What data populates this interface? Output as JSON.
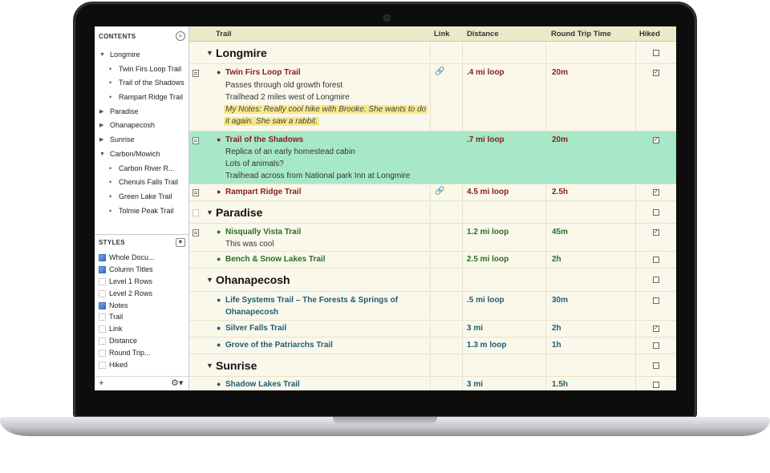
{
  "sidebar": {
    "contents_heading": "CONTENTS",
    "contents": [
      {
        "label": "Longmire",
        "level": 1,
        "expanded": true
      },
      {
        "label": "Twin Firs Loop Trail",
        "level": 2
      },
      {
        "label": "Trail of the Shadows",
        "level": 2
      },
      {
        "label": "Rampart Ridge Trail",
        "level": 2
      },
      {
        "label": "Paradise",
        "level": 1,
        "expanded": false
      },
      {
        "label": "Ohanapecosh",
        "level": 1,
        "expanded": false
      },
      {
        "label": "Sunrise",
        "level": 1,
        "expanded": false
      },
      {
        "label": "Carbon/Mowich",
        "level": 1,
        "expanded": true
      },
      {
        "label": "Carbon River R...",
        "level": 2
      },
      {
        "label": "Chenuis Falls Trail",
        "level": 2
      },
      {
        "label": "Green Lake Trail",
        "level": 2
      },
      {
        "label": "Tolmie Peak Trail",
        "level": 2
      }
    ],
    "styles_heading": "STYLES",
    "styles": [
      {
        "label": "Whole Docu...",
        "filled": true
      },
      {
        "label": "Column Titles",
        "filled": true
      },
      {
        "label": "Level 1 Rows",
        "filled": false
      },
      {
        "label": "Level 2 Rows",
        "filled": false
      },
      {
        "label": "Notes",
        "filled": true
      },
      {
        "label": "Trail",
        "filled": false
      },
      {
        "label": "Link",
        "filled": false
      },
      {
        "label": "Distance",
        "filled": false
      },
      {
        "label": "Round Trip...",
        "filled": false
      },
      {
        "label": "Hiked",
        "filled": false
      }
    ],
    "add_label": "+",
    "gear_label": "⚙▾"
  },
  "columns": {
    "trail": "Trail",
    "link": "Link",
    "distance": "Distance",
    "round_trip": "Round Trip Time",
    "hiked": "Hiked"
  },
  "colors": {
    "selected_row": "#a6e8c8",
    "highlight_note": "#f8e888",
    "longmire_text": "#8a1b1b",
    "paradise_text": "#2c6b27",
    "ohanapecosh_text": "#1f5b72"
  },
  "outline": {
    "longmire": {
      "title": "Longmire",
      "twin_firs": {
        "title": "Twin Firs Loop Trail",
        "note1": "Passes through old growth forest",
        "note2": "Trailhead 2 miles west of Longmire",
        "note3": "My Notes: Really cool hike with Brooke. She wants to do",
        "note4": "it again. She saw a rabbit.",
        "distance": ".4 mi loop",
        "time": "20m",
        "hiked": true,
        "link": "🔗"
      },
      "shadows": {
        "title": "Trail of the Shadows",
        "note1": "Replica of an early homestead cabin",
        "note2": "Lots of animals?",
        "note3": "Trailhead across from National park Inn at Longmire",
        "distance": ".7 mi loop",
        "time": "20m",
        "hiked": true
      },
      "rampart": {
        "title": "Rampart Ridge Trail",
        "distance": "4.5 mi loop",
        "time": "2.5h",
        "hiked": true,
        "link": "🔗"
      }
    },
    "paradise": {
      "title": "Paradise",
      "nisqually": {
        "title": "Nisqually Vista Trail",
        "note1": "This was cool",
        "distance": "1.2 mi loop",
        "time": "45m",
        "hiked": true
      },
      "bench": {
        "title": "Bench & Snow Lakes Trail",
        "distance": "2.5 mi loop",
        "time": "2h",
        "hiked": false
      }
    },
    "ohanapecosh": {
      "title": "Ohanapecosh",
      "life": {
        "title1": "Life Systems Trail – The Forests & Springs of",
        "title2": "Ohanapecosh",
        "distance": ".5 mi loop",
        "time": "30m",
        "hiked": false
      },
      "silver": {
        "title": "Silver Falls Trail",
        "distance": "3 mi",
        "time": "2h",
        "hiked": true
      },
      "grove": {
        "title": "Grove of the Patriarchs Trail",
        "distance": "1.3 m loop",
        "time": "1h",
        "hiked": false
      }
    },
    "sunrise": {
      "title": "Sunrise",
      "shadow_lakes": {
        "title": "Shadow Lakes Trail",
        "distance": "3 mi",
        "time": "1.5h",
        "hiked": false
      }
    }
  }
}
